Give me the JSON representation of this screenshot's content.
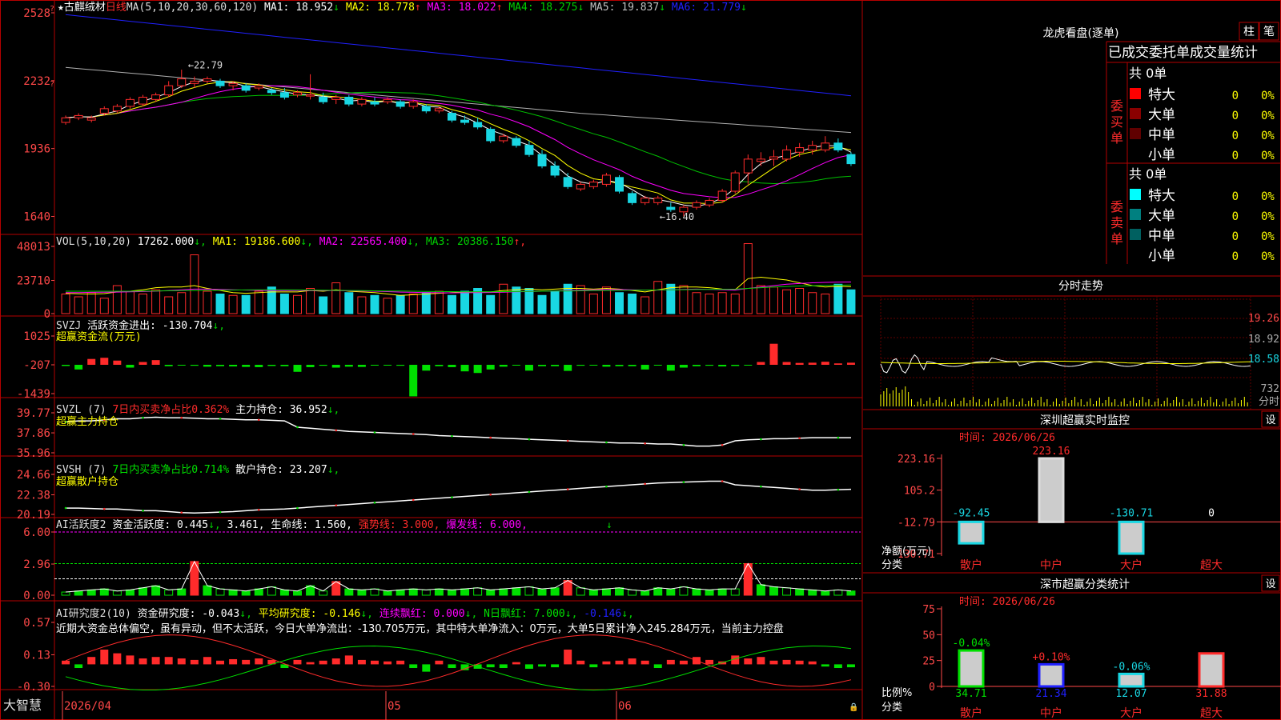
{
  "stock": {
    "star": "★",
    "name": "古麒绒材",
    "period": "日线"
  },
  "colors": {
    "bg": "#000000",
    "up": "#ff2b2b",
    "down": "#19d7e3",
    "frame": "#b40000",
    "axis_text": "#ff4848",
    "white": "#ffffff",
    "yellow": "#ffff00",
    "magenta": "#ff00ff",
    "green": "#00d000",
    "gray": "#a0a0a0",
    "blue": "#2020ff"
  },
  "kline": {
    "ma_header": "MA(5,10,20,30,60,120)",
    "ma": [
      {
        "label": "MA1:",
        "value": "18.952",
        "arrow": "↓",
        "color": "#ffffff"
      },
      {
        "label": "MA2:",
        "value": "18.778",
        "arrow": "↑",
        "color": "#ffff00"
      },
      {
        "label": "MA3:",
        "value": "18.022",
        "arrow": "↑",
        "color": "#ff00ff"
      },
      {
        "label": "MA4:",
        "value": "18.275",
        "arrow": "↓",
        "color": "#00d000"
      },
      {
        "label": "MA5:",
        "value": "19.837",
        "arrow": "↓",
        "color": "#c0c0c0"
      },
      {
        "label": "MA6:",
        "value": "21.779",
        "arrow": "↓",
        "color": "#2020ff"
      }
    ],
    "y_ticks": [
      "2528",
      "2232",
      "1936",
      "1640"
    ],
    "y_range": [
      16.0,
      25.35
    ],
    "hi_label": "22.79",
    "lo_label": "16.40",
    "bars": [
      [
        20.5,
        20.8,
        20.4,
        20.7
      ],
      [
        20.7,
        20.9,
        20.6,
        20.8
      ],
      [
        20.6,
        20.8,
        20.5,
        20.7
      ],
      [
        20.9,
        21.2,
        20.8,
        21.1
      ],
      [
        21.0,
        21.3,
        20.9,
        21.2
      ],
      [
        21.2,
        21.6,
        21.1,
        21.5
      ],
      [
        21.3,
        21.7,
        21.2,
        21.6
      ],
      [
        21.5,
        21.8,
        21.4,
        21.7
      ],
      [
        21.7,
        22.3,
        21.6,
        22.1
      ],
      [
        22.1,
        22.8,
        22.0,
        22.4
      ],
      [
        22.2,
        22.5,
        22.0,
        22.3
      ],
      [
        22.3,
        22.5,
        22.2,
        22.4
      ],
      [
        22.3,
        22.4,
        22.0,
        22.1
      ],
      [
        22.1,
        22.3,
        21.9,
        22.2
      ],
      [
        22.1,
        22.2,
        21.8,
        21.9
      ],
      [
        22.0,
        22.2,
        21.9,
        22.1
      ],
      [
        21.9,
        22.0,
        21.7,
        21.8
      ],
      [
        21.8,
        22.0,
        21.5,
        21.6
      ],
      [
        21.7,
        21.9,
        21.6,
        21.8
      ],
      [
        21.7,
        22.6,
        21.5,
        21.7
      ],
      [
        21.6,
        21.8,
        21.3,
        21.4
      ],
      [
        21.5,
        21.7,
        21.3,
        21.6
      ],
      [
        21.6,
        21.7,
        21.2,
        21.3
      ],
      [
        21.3,
        21.6,
        21.2,
        21.5
      ],
      [
        21.4,
        21.6,
        21.2,
        21.3
      ],
      [
        21.4,
        21.6,
        21.3,
        21.5
      ],
      [
        21.4,
        21.5,
        21.1,
        21.2
      ],
      [
        21.2,
        21.5,
        21.1,
        21.4
      ],
      [
        21.2,
        21.3,
        20.9,
        21.0
      ],
      [
        21.0,
        21.2,
        20.9,
        21.1
      ],
      [
        20.9,
        21.0,
        20.5,
        20.6
      ],
      [
        20.6,
        20.8,
        20.4,
        20.5
      ],
      [
        20.5,
        20.7,
        20.2,
        20.3
      ],
      [
        20.2,
        20.3,
        19.6,
        19.7
      ],
      [
        19.7,
        20.0,
        19.6,
        19.9
      ],
      [
        19.8,
        19.9,
        19.4,
        19.5
      ],
      [
        19.5,
        19.7,
        19.0,
        19.1
      ],
      [
        19.1,
        19.3,
        18.5,
        18.6
      ],
      [
        18.6,
        18.8,
        18.1,
        18.2
      ],
      [
        18.1,
        18.3,
        17.6,
        17.7
      ],
      [
        17.6,
        17.9,
        17.5,
        17.8
      ],
      [
        17.7,
        18.0,
        17.6,
        17.9
      ],
      [
        17.8,
        18.3,
        17.7,
        18.2
      ],
      [
        18.1,
        18.2,
        17.4,
        17.5
      ],
      [
        17.4,
        17.5,
        16.9,
        17.0
      ],
      [
        17.0,
        17.3,
        16.9,
        17.2
      ],
      [
        17.0,
        17.3,
        16.9,
        17.2
      ],
      [
        16.8,
        17.0,
        16.6,
        16.7
      ],
      [
        16.6,
        16.9,
        16.4,
        16.8
      ],
      [
        16.8,
        17.1,
        16.7,
        17.0
      ],
      [
        16.9,
        17.2,
        16.8,
        17.1
      ],
      [
        17.1,
        17.6,
        17.0,
        17.5
      ],
      [
        17.5,
        18.4,
        17.4,
        18.3
      ],
      [
        18.3,
        19.1,
        17.8,
        18.9
      ],
      [
        18.8,
        19.2,
        18.6,
        18.9
      ],
      [
        18.9,
        19.3,
        18.6,
        19.0
      ],
      [
        18.9,
        19.5,
        18.8,
        19.3
      ],
      [
        19.2,
        19.6,
        19.0,
        19.4
      ],
      [
        19.3,
        19.7,
        19.1,
        19.5
      ],
      [
        19.3,
        19.9,
        19.2,
        19.6
      ],
      [
        19.6,
        19.8,
        19.2,
        19.3
      ],
      [
        19.1,
        19.2,
        18.6,
        18.7
      ]
    ]
  },
  "volume": {
    "header": "VOL(5,10,20)",
    "val": "17262.000",
    "val_arrow": "↓",
    "ma": [
      {
        "label": "MA1:",
        "value": "19186.600",
        "arrow": "↓",
        "color": "#ffff00"
      },
      {
        "label": "MA2:",
        "value": "22565.400",
        "arrow": "↓",
        "color": "#ff00ff"
      },
      {
        "label": "MA3:",
        "value": "20386.150",
        "arrow": "↑",
        "color": "#00d000"
      }
    ],
    "y_ticks": [
      "48013",
      "23710",
      "0"
    ],
    "max": 48013,
    "values": [
      14000,
      12000,
      15000,
      11000,
      20000,
      16000,
      14000,
      17000,
      12000,
      15000,
      42000,
      16000,
      14000,
      13000,
      13000,
      16000,
      19000,
      14000,
      13000,
      18000,
      12000,
      22000,
      15000,
      12000,
      13000,
      11000,
      13000,
      14000,
      15000,
      16000,
      13000,
      16000,
      18000,
      13000,
      21000,
      19000,
      18000,
      13000,
      16000,
      21000,
      20000,
      14000,
      19000,
      15000,
      14000,
      12000,
      23000,
      21000,
      20000,
      15000,
      14000,
      15000,
      14000,
      50000,
      20000,
      19000,
      17000,
      18000,
      15000,
      14000,
      21000,
      17000
    ],
    "ma_lines": [
      {
        "color": "#ffff00",
        "values": [
          14500,
          14200,
          14000,
          14300,
          15500,
          16000,
          17000,
          18500,
          19000,
          19000,
          20000,
          18000,
          16500,
          15000,
          14500,
          15000,
          15500,
          15500,
          15500,
          16500,
          16000,
          17000,
          16000,
          15500,
          15000,
          14000,
          13000,
          13500,
          14000,
          14500,
          15000,
          15500,
          15500,
          15500,
          16500,
          17000,
          17500,
          17000,
          17500,
          18000,
          18000,
          17500,
          18000,
          17500,
          16500,
          15500,
          17000,
          18500,
          19000,
          19000,
          18500,
          17500,
          17000,
          25000,
          26000,
          25000,
          24000,
          22000,
          20000,
          19000,
          19500,
          19200
        ]
      },
      {
        "color": "#ff00ff",
        "values": [
          15000,
          15000,
          15200,
          15300,
          15400,
          15600,
          15800,
          16000,
          16500,
          17000,
          17500,
          17500,
          17300,
          17000,
          16800,
          16600,
          16400,
          16400,
          16500,
          16500,
          16400,
          16400,
          16300,
          16200,
          16000,
          15700,
          15400,
          15200,
          15000,
          14900,
          14800,
          14900,
          15000,
          15100,
          15300,
          15600,
          15800,
          16000,
          16200,
          16500,
          16800,
          17000,
          17200,
          17200,
          17000,
          16800,
          16800,
          17000,
          17300,
          17500,
          17300,
          17000,
          16800,
          18000,
          19000,
          20000,
          21000,
          21500,
          22000,
          22300,
          22500,
          22565
        ]
      },
      {
        "color": "#00d000",
        "values": [
          16000,
          16000,
          16000,
          16000,
          16000,
          16000,
          16100,
          16200,
          16300,
          16400,
          16500,
          16600,
          16700,
          16800,
          16900,
          17000,
          17000,
          17000,
          16900,
          16800,
          16700,
          16600,
          16500,
          16400,
          16300,
          16200,
          16100,
          16000,
          15900,
          15800,
          15700,
          15600,
          15600,
          15600,
          15700,
          15800,
          15900,
          16000,
          16100,
          16200,
          16300,
          16400,
          16500,
          16600,
          16700,
          16800,
          16900,
          17000,
          17100,
          17200,
          17300,
          17400,
          17500,
          18000,
          18500,
          19000,
          19400,
          19700,
          19900,
          20100,
          20300,
          20386
        ]
      }
    ]
  },
  "svzj": {
    "header": "SVZJ",
    "line1": "活跃资金进出:",
    "value": "-130.704",
    "arrow": "↓",
    "line2": "超赢资金流(万元)",
    "y_ticks": [
      "1025",
      "-207",
      "-1439"
    ],
    "range": [
      -1439,
      1025
    ],
    "values": [
      -50,
      -200,
      250,
      300,
      180,
      -120,
      120,
      200,
      -60,
      -30,
      -40,
      -80,
      -60,
      -70,
      -90,
      -100,
      -50,
      -60,
      -300,
      -100,
      -40,
      -120,
      -80,
      -90,
      -30,
      -20,
      -40,
      -1350,
      -250,
      -60,
      -100,
      -280,
      -350,
      -200,
      -80,
      -20,
      -250,
      -60,
      -60,
      -260,
      -40,
      -30,
      -80,
      -60,
      -60,
      -200,
      -30,
      -250,
      -120,
      -60,
      -40,
      -70,
      -50,
      -30,
      120,
      900,
      120,
      80,
      90,
      130,
      60,
      90,
      -80
    ]
  },
  "svzl": {
    "header": "SVZL (7)",
    "sub": "7日内买卖净占比0.362%",
    "main_label": "主力持仓:",
    "main_value": "36.952",
    "arrow": "↓",
    "line2": "超赢主力持仓",
    "y_ticks": [
      "39.77",
      "37.86",
      "35.96"
    ],
    "range": [
      35.96,
      39.77
    ],
    "values": [
      38.9,
      39.0,
      39.0,
      39.1,
      39.2,
      39.2,
      39.3,
      39.35,
      39.3,
      39.3,
      39.25,
      39.2,
      39.2,
      39.15,
      39.1,
      39.1,
      39.05,
      39.0,
      38.4,
      38.3,
      38.2,
      38.1,
      38.0,
      37.95,
      37.9,
      37.85,
      37.8,
      37.75,
      37.7,
      37.6,
      37.55,
      37.5,
      37.45,
      37.4,
      37.35,
      37.3,
      37.25,
      37.2,
      37.15,
      37.1,
      37.05,
      37.0,
      36.95,
      36.9,
      36.9,
      36.85,
      36.8,
      36.8,
      36.7,
      36.6,
      36.6,
      36.7,
      37.1,
      37.2,
      37.25,
      37.3,
      37.3,
      37.35,
      37.4,
      37.4,
      37.4,
      37.4
    ]
  },
  "svsh": {
    "header": "SVSH (7)",
    "sub": "7日内买卖净占比0.714%",
    "main_label": "散户持仓:",
    "main_value": "23.207",
    "arrow": "↓",
    "line2": "超赢散户持仓",
    "y_ticks": [
      "24.66",
      "22.38",
      "20.19"
    ],
    "range": [
      20.19,
      24.66
    ],
    "values": [
      20.9,
      20.9,
      20.85,
      20.8,
      20.8,
      20.7,
      20.6,
      20.6,
      20.5,
      20.4,
      20.35,
      20.4,
      20.45,
      20.5,
      20.6,
      20.7,
      20.75,
      20.8,
      20.9,
      21.0,
      21.1,
      21.2,
      21.3,
      21.4,
      21.5,
      21.6,
      21.7,
      21.8,
      21.9,
      22.0,
      22.1,
      22.2,
      22.3,
      22.4,
      22.5,
      22.6,
      22.7,
      22.8,
      22.9,
      23.0,
      23.1,
      23.2,
      23.3,
      23.4,
      23.5,
      23.6,
      23.7,
      23.75,
      23.8,
      23.85,
      23.9,
      23.9,
      23.5,
      23.4,
      23.3,
      23.2,
      23.1,
      23.0,
      22.9,
      22.9,
      22.95,
      23.0
    ]
  },
  "ai_active": {
    "header": "AI活跃度2",
    "l1": "资金活跃度:",
    "v1": "0.445",
    "a1": "↓",
    "v1b": "3.461",
    "l2": "生命线:",
    "v2": "1.560",
    "l3": "强势线:",
    "v3": "3.000",
    "l4": "爆发线:",
    "v4": "6.000",
    "y_ticks": [
      "6.00",
      "2.96",
      "0.00"
    ],
    "max": 6.0,
    "values": [
      0.3,
      0.4,
      0.5,
      0.6,
      0.4,
      0.5,
      0.7,
      0.9,
      0.5,
      0.6,
      3.2,
      0.9,
      0.6,
      0.5,
      0.4,
      0.6,
      0.8,
      0.5,
      0.4,
      0.9,
      0.4,
      1.3,
      0.6,
      0.5,
      0.6,
      0.4,
      0.5,
      0.6,
      0.5,
      0.6,
      0.5,
      0.6,
      0.7,
      0.5,
      0.6,
      0.7,
      0.8,
      0.6,
      0.7,
      1.4,
      0.7,
      0.5,
      0.6,
      0.7,
      0.5,
      0.4,
      0.7,
      0.6,
      0.8,
      0.6,
      0.5,
      0.6,
      0.6,
      3.0,
      1.0,
      0.8,
      0.7,
      0.6,
      0.5,
      0.4,
      0.5,
      0.4
    ]
  },
  "ai_research": {
    "header": "AI研究度2(10)",
    "l1": "资金研究度:",
    "v1": "-0.043",
    "a1": "↓",
    "l2": "平均研究度:",
    "v2": "-0.146",
    "a2": "↓",
    "l3": "连续飘红:",
    "v3": "0.000",
    "a3": "↓",
    "l4": "N日飘红:",
    "v4": "7.000",
    "a4": "↓",
    "v5": "-0.146",
    "a5": "↓",
    "text": "近期大资金总体偏空，虽有异动，但不太活跃，今日大单净流出：-130.705万元，其中特大单净流入：0万元，大单5日累计净入245.284万元，当前主力控盘",
    "y_ticks": [
      "0.57",
      "0.13",
      "-0.30"
    ],
    "range": [
      -0.3,
      0.57
    ],
    "values": [
      0.05,
      -0.05,
      0.1,
      0.2,
      0.15,
      0.12,
      0.08,
      0.1,
      0.1,
      0.08,
      0.06,
      0.1,
      0.05,
      0.07,
      0.06,
      0.08,
      0.06,
      -0.05,
      0.06,
      0.03,
      0.05,
      0.08,
      0.12,
      0.06,
      0.05,
      0.04,
      0.05,
      -0.05,
      -0.1,
      0.05,
      -0.05,
      -0.08,
      -0.06,
      -0.04,
      -0.05,
      0.03,
      -0.06,
      -0.03,
      -0.04,
      0.2,
      0.05,
      -0.04,
      0.04,
      0.05,
      0.08,
      0.05,
      -0.05,
      0.06,
      0.05,
      0.1,
      0.06,
      0.04,
      0.12,
      0.08,
      0.1,
      0.05,
      0.06,
      0.05,
      0.04,
      -0.03,
      -0.05,
      -0.04
    ]
  },
  "x_axis": {
    "labels": [
      "2026/04",
      "05",
      "06"
    ]
  },
  "brand": "大智慧",
  "lhb": {
    "title": "龙虎看盘(逐单)",
    "btn1": "柱",
    "btn2": "笔",
    "section": "已成交委托单成交量统计",
    "buy_label": "委买单",
    "sell_label": "委卖单",
    "buy_total": "共 0单",
    "sell_total": "共 0单",
    "buy_rows": [
      {
        "name": "特大",
        "count": "0",
        "pct": "0%",
        "color": "#ff0000"
      },
      {
        "name": "大单",
        "count": "0",
        "pct": "0%",
        "color": "#8a0000"
      },
      {
        "name": "中单",
        "count": "0",
        "pct": "0%",
        "color": "#600000"
      },
      {
        "name": "小单",
        "count": "0",
        "pct": "0%",
        "color": "#000000"
      }
    ],
    "sell_rows": [
      {
        "name": "特大",
        "count": "0",
        "pct": "0%",
        "color": "#00ffff"
      },
      {
        "name": "大单",
        "count": "0",
        "pct": "0%",
        "color": "#008080"
      },
      {
        "name": "中单",
        "count": "0",
        "pct": "0%",
        "color": "#006060"
      },
      {
        "name": "小单",
        "count": "0",
        "pct": "0%",
        "color": "#000000"
      }
    ]
  },
  "fenshi": {
    "title": "分时走势",
    "y_labels": [
      "19.26",
      "18.92",
      "18.58",
      "732"
    ],
    "vol_label": "分时"
  },
  "sz_monitor": {
    "title": "深圳超赢实时监控",
    "btn": "设",
    "time": "时间: 2026/06/26",
    "y_ticks": [
      "223.16",
      "105.2",
      "-12.79",
      "-130.71"
    ],
    "net_label": "净额(万元)",
    "cat_label": "分类",
    "bars": [
      {
        "name": "散户",
        "value": "-92.45",
        "v": -92.45
      },
      {
        "name": "中户",
        "value": "223.16",
        "v": 223.16
      },
      {
        "name": "大户",
        "value": "-130.71",
        "v": -130.71
      },
      {
        "name": "超大",
        "value": "0",
        "v": 0
      }
    ]
  },
  "sz_class": {
    "title": "深市超赢分类统计",
    "btn": "设",
    "time": "时间: 2026/06/26",
    "y_ticks": [
      "75",
      "50",
      "25",
      "0"
    ],
    "ratio_label": "比例%",
    "cat_label": "分类",
    "bars": [
      {
        "name": "散户",
        "value": "34.71",
        "change": "-0.04%",
        "v": 34.71
      },
      {
        "name": "中户",
        "value": "21.34",
        "change": "+0.10%",
        "v": 21.34
      },
      {
        "name": "大户",
        "value": "12.07",
        "change": "-0.06%",
        "v": 12.07
      },
      {
        "name": "超大",
        "value": "31.88",
        "change": "",
        "v": 31.88
      }
    ]
  }
}
